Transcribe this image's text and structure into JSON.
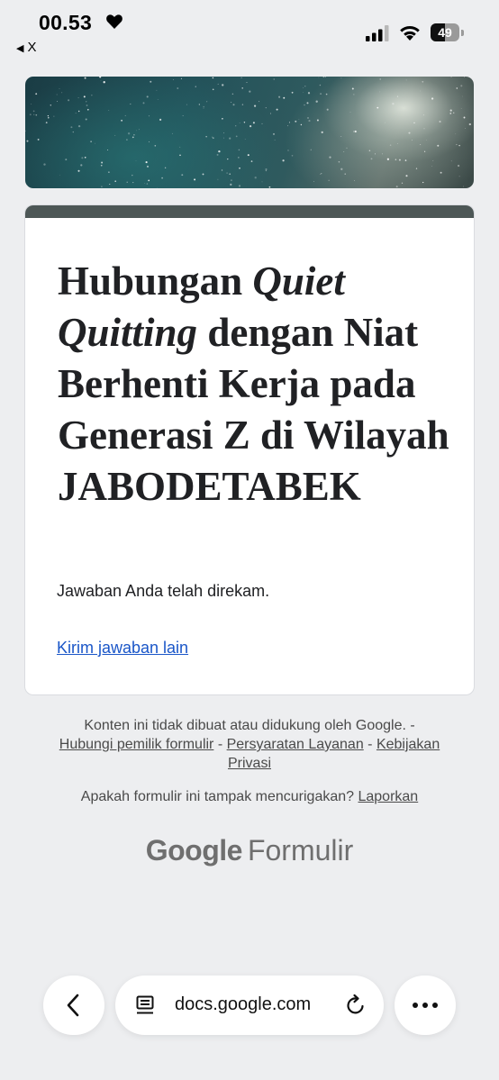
{
  "status_bar": {
    "time": "00.53",
    "back_app_label": "X",
    "battery_level": "49",
    "battery_fraction": 0.49
  },
  "icons": {
    "heart": "heart-icon",
    "back_app": "back-triangle-icon",
    "signal": "cellular-signal-icon",
    "wifi": "wifi-icon",
    "battery": "battery-icon",
    "nav_back": "chevron-left-icon",
    "page_menu": "page-menu-icon",
    "reload": "reload-icon",
    "more": "ellipsis-icon"
  },
  "form": {
    "title_part1": "Hubungan ",
    "title_italic": "Quiet Quitting",
    "title_part2": " dengan Niat Berhenti Kerja pada Generasi Z di Wilayah JABODETABEK",
    "response_message": "Jawaban Anda telah direkam.",
    "submit_another_link": "Kirim jawaban lain"
  },
  "footer": {
    "disclaimer": "Konten ini tidak dibuat atau didukung oleh Google. -",
    "contact_owner": "Hubungi pemilik formulir",
    "sep1": " - ",
    "terms": "Persyaratan Layanan",
    "sep2": " - ",
    "privacy": "Kebijakan Privasi",
    "suspicious_question": "Apakah formulir ini tampak mencurigakan? ",
    "report": "Laporkan",
    "brand_google": "Google",
    "brand_forms": "Formulir"
  },
  "browser": {
    "url": "docs.google.com"
  },
  "colors": {
    "background": "#edeef0",
    "card_header": "#4d5756",
    "link": "#1a56c8"
  }
}
